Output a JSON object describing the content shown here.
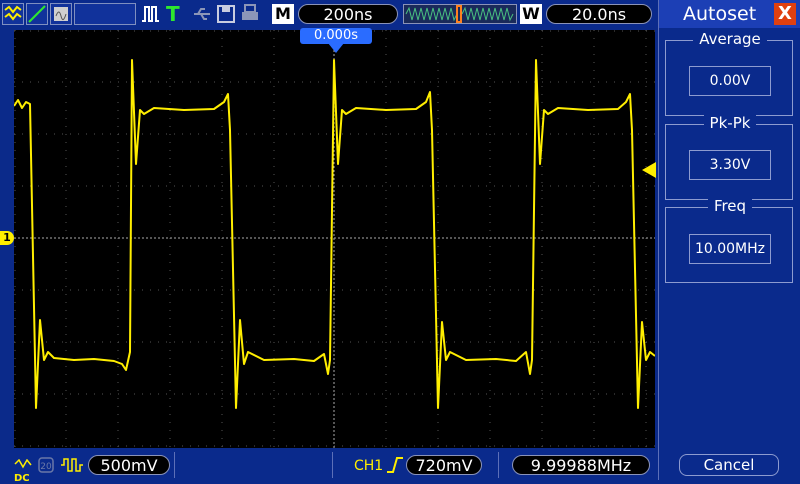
{
  "toolbar": {
    "mode_letter": "M",
    "timebase": "200ns",
    "w_letter": "W",
    "window_time": "20.0ns",
    "trigger_letter": "T"
  },
  "trigger_offset": "0.000s",
  "channel_marker": "1",
  "panel": {
    "title": "Autoset",
    "close_symbol": "X",
    "measurements": [
      {
        "label": "Average",
        "value": "0.00V"
      },
      {
        "label": "Pk-Pk",
        "value": "3.30V"
      },
      {
        "label": "Freq",
        "value": "10.00MHz"
      }
    ],
    "cancel_label": "Cancel"
  },
  "bottom": {
    "coupling": "DC",
    "volts_div": "500mV",
    "channel": "CH1",
    "trigger_level": "720mV",
    "frequency": "9.99988MHz"
  },
  "colors": {
    "trace": "#ffee00",
    "screen_bg": "#000000",
    "chrome_bg": "#0a2a8c",
    "marker_blue": "#2a6cff"
  }
}
